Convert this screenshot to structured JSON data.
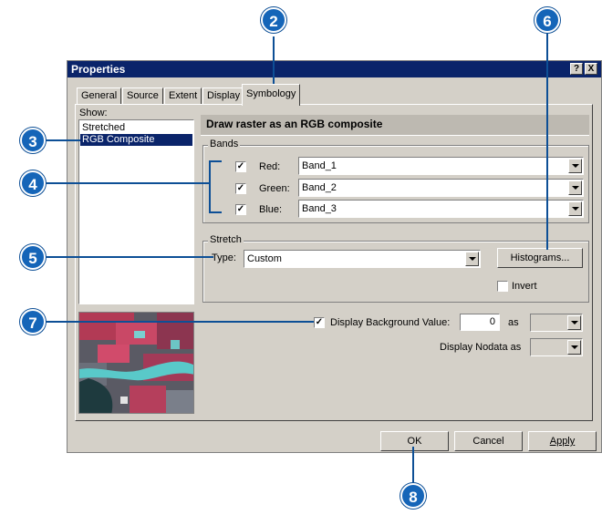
{
  "window": {
    "title": "Properties",
    "help_button": "?",
    "close_button": "X"
  },
  "tabs": [
    {
      "label": "General"
    },
    {
      "label": "Source"
    },
    {
      "label": "Extent"
    },
    {
      "label": "Display"
    },
    {
      "label": "Symbology",
      "active": true
    }
  ],
  "show": {
    "label": "Show:",
    "items": [
      {
        "label": "Stretched",
        "selected": false
      },
      {
        "label": "RGB Composite",
        "selected": true
      }
    ]
  },
  "header_title": "Draw raster as an RGB composite",
  "bands": {
    "group_label": "Bands",
    "rows": [
      {
        "checked": true,
        "label": "Red:",
        "value": "Band_1"
      },
      {
        "checked": true,
        "label": "Green:",
        "value": "Band_2"
      },
      {
        "checked": true,
        "label": "Blue:",
        "value": "Band_3"
      }
    ]
  },
  "stretch": {
    "group_label": "Stretch",
    "type_label": "Type:",
    "type_value": "Custom",
    "histograms_button": "Histograms...",
    "invert_label": "Invert",
    "invert_checked": false
  },
  "background": {
    "checked": true,
    "label": "Display Background Value:",
    "value": "0",
    "as_label": "as"
  },
  "nodata": {
    "label": "Display Nodata as"
  },
  "buttons": {
    "ok": "OK",
    "cancel": "Cancel",
    "apply": "Apply"
  },
  "callouts": [
    "2",
    "3",
    "4",
    "5",
    "6",
    "7",
    "8"
  ],
  "colors": {
    "callout": "#1565b8",
    "titlebar": "#0a246a",
    "selection": "#0a246a",
    "dialog": "#d4d0c8"
  }
}
